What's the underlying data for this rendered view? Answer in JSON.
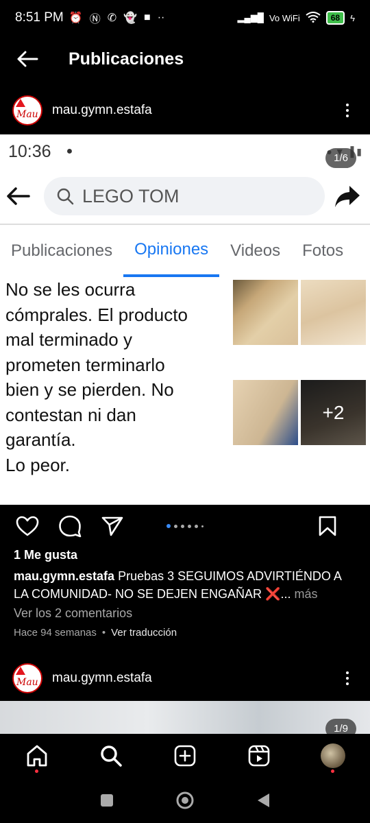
{
  "status_bar": {
    "time": "8:51 PM",
    "network_label": "Vo WiFi",
    "battery": "68"
  },
  "header": {
    "title": "Publicaciones"
  },
  "post": {
    "username": "mau.gymn.estafa",
    "avatar_text": "Mau",
    "image_counter": "1/6",
    "embedded": {
      "time": "10:36",
      "search_text": "LEGO TOM",
      "tabs": [
        "Publicaciones",
        "Opiniones",
        "Videos",
        "Fotos"
      ],
      "active_tab": "Opiniones",
      "review_lines": [
        "No se les ocurra",
        "cómprales. El producto",
        "mal terminado y",
        "prometen terminarlo",
        "bien y se pierden. No",
        "contestan ni dan",
        "garantía.",
        "Lo peor."
      ],
      "extra_photos": "+2"
    },
    "likes": "1 Me gusta",
    "caption_user": "mau.gymn.estafa",
    "caption_text": "Pruebas 3 SEGUIMOS ADVIRTIÉNDO A LA COMUNIDAD- NO SE DEJEN ENGAÑAR ❌...",
    "caption_more": "más",
    "view_comments": "Ver los 2 comentarios",
    "time_ago": "Hace 94 semanas",
    "translate": "Ver traducción"
  },
  "next_post": {
    "username": "mau.gymn.estafa",
    "avatar_text": "Mau",
    "image_counter": "1/9"
  },
  "icons": {
    "back": "arrow-left-icon",
    "like": "heart-icon",
    "comment": "comment-icon",
    "share": "send-icon",
    "save": "bookmark-icon",
    "home": "home-icon",
    "search": "search-icon",
    "create": "plus-square-icon",
    "reels": "reels-icon"
  },
  "colors": {
    "accent_blue": "#1877f2",
    "notification_red": "#ff3040"
  }
}
